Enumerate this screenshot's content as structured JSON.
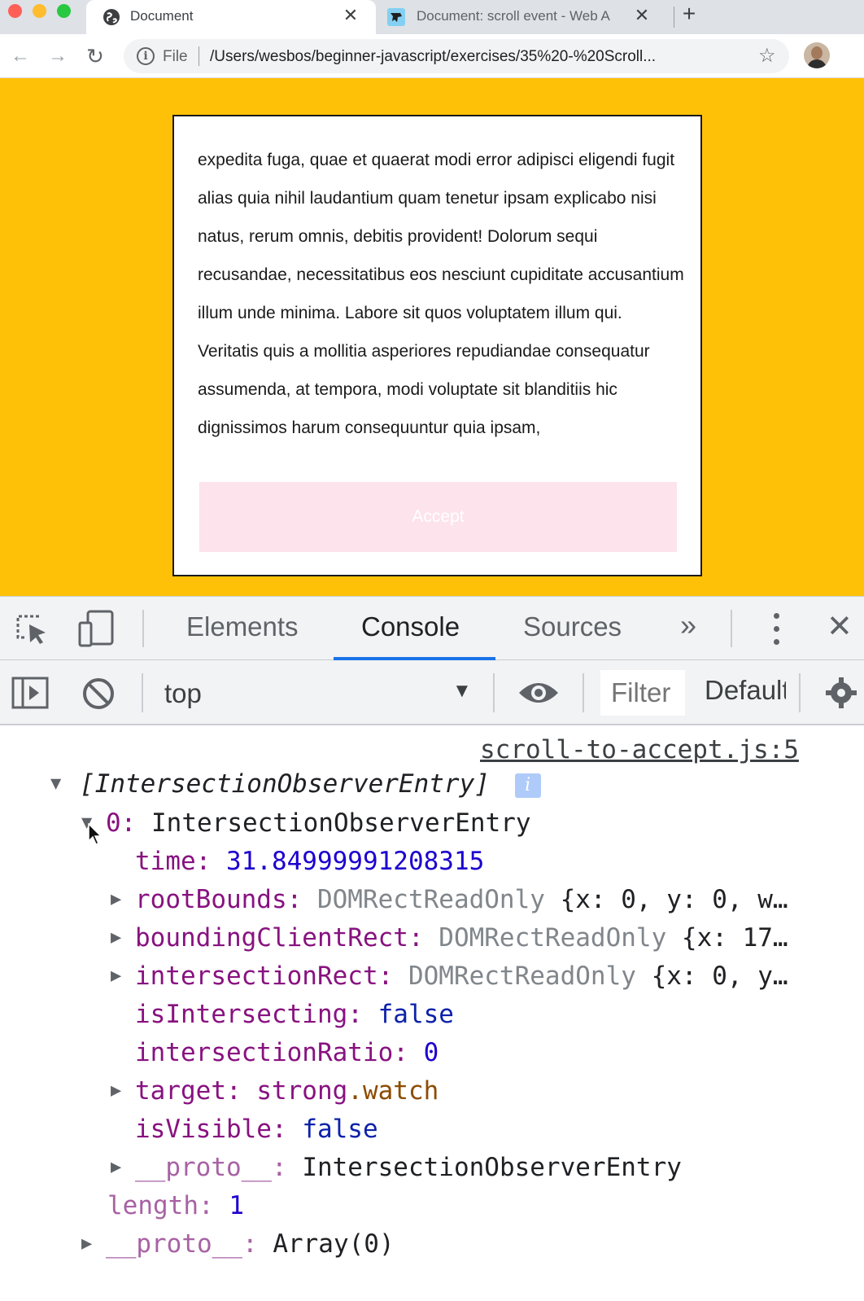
{
  "browser": {
    "tabs": [
      {
        "title": "Document",
        "active": true
      },
      {
        "title": "Document: scroll event - Web A",
        "active": false
      }
    ],
    "omnibox": {
      "scheme_label": "File",
      "url": "/Users/wesbos/beginner-javascript/exercises/35%20-%20Scroll..."
    }
  },
  "page": {
    "terms_text": "expedita fuga, quae et quaerat modi error adipisci eligendi fugit alias quia nihil laudantium quam tenetur ipsam explicabo nisi natus, rerum omnis, debitis provident! Dolorum sequi recusandae, necessitatibus eos nesciunt cupiditate accusantium illum unde minima. Labore sit quos voluptatem illum qui. Veritatis quis a mollitia asperiores repudiandae consequatur assumenda, at tempora, modi voluptate sit blanditiis hic dignissimos harum consequuntur quia ipsam,",
    "accept_label": "Accept",
    "colors": {
      "background": "#ffc107",
      "accept_disabled": "#fde2ea"
    }
  },
  "devtools": {
    "tabs": [
      "Elements",
      "Console",
      "Sources"
    ],
    "active_tab": "Console",
    "more_tabs": "»",
    "context": "top",
    "filter_placeholder": "Filter",
    "levels": "Default levels",
    "accent": "#1a73e8"
  },
  "console": {
    "source": "scroll-to-accept.js:5",
    "array_label": "[IntersectionObserverEntry]",
    "info_badge": "i",
    "entry_index": "0",
    "entry_type": "IntersectionObserverEntry",
    "time_key": "time",
    "time_value": "31.84999991208315",
    "rootBounds_key": "rootBounds",
    "rootBounds_type": "DOMRectReadOnly",
    "rootBounds_preview": "{x: 0, y: 0, w…",
    "bcr_key": "boundingClientRect",
    "bcr_type": "DOMRectReadOnly",
    "bcr_preview": "{x: 17…",
    "ir_key": "intersectionRect",
    "ir_type": "DOMRectReadOnly",
    "ir_preview": "{x: 0, y…",
    "isIntersecting_key": "isIntersecting",
    "isIntersecting_value": "false",
    "ratio_key": "intersectionRatio",
    "ratio_value": "0",
    "target_key": "target",
    "target_tag": "strong",
    "target_class": ".watch",
    "isVisible_key": "isVisible",
    "isVisible_value": "false",
    "entry_proto_key": "__proto__",
    "entry_proto_value": "IntersectionObserverEntry",
    "length_key": "length",
    "length_value": "1",
    "array_proto_key": "__proto__",
    "array_proto_value": "Array(0)"
  }
}
